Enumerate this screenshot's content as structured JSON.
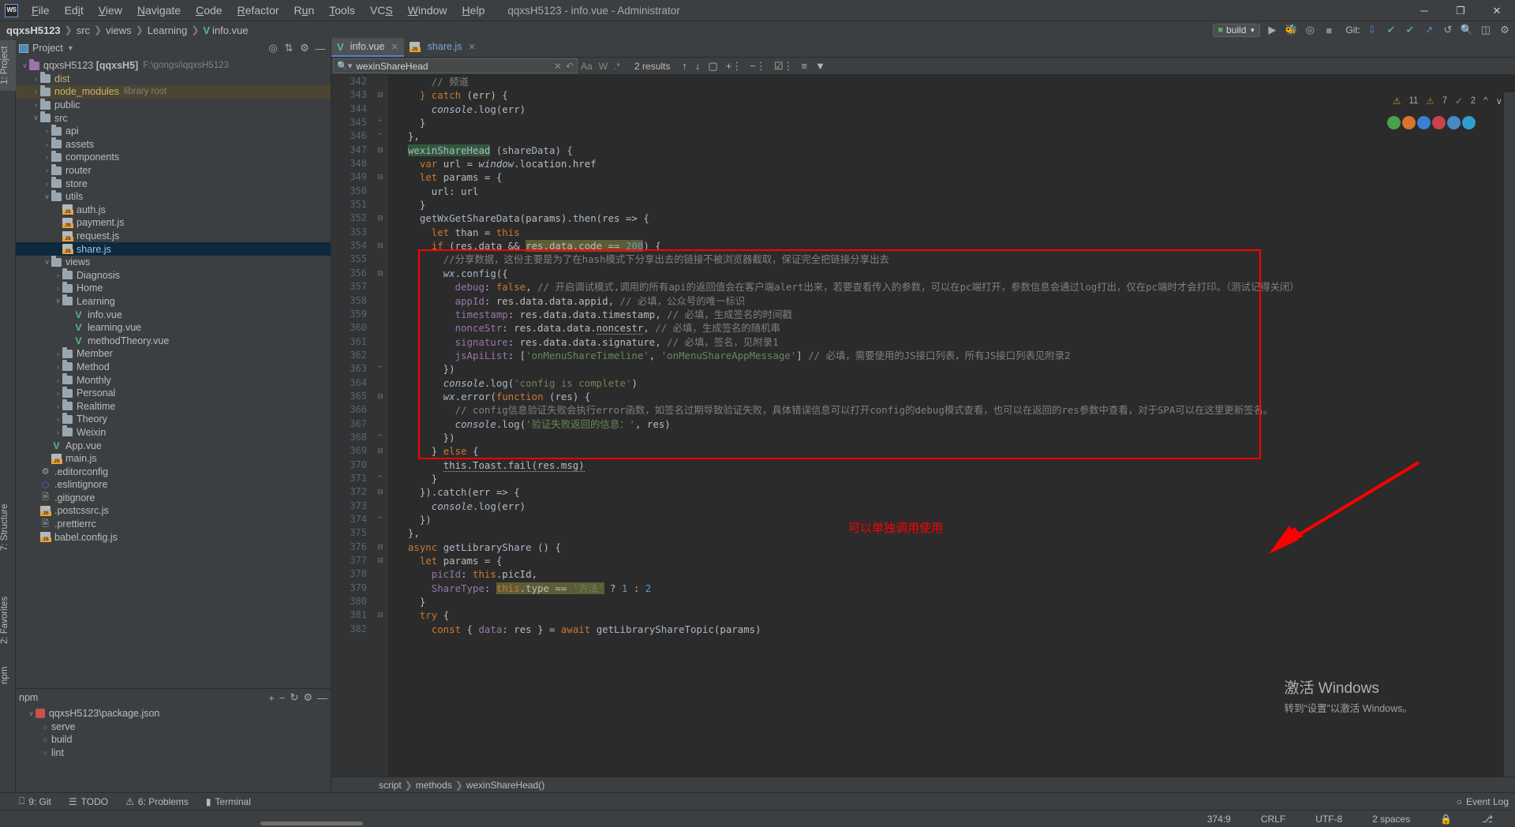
{
  "window": {
    "title": "qqxsH5123 - info.vue - Administrator",
    "logo": "WS",
    "minimize": "─",
    "maximize": "❐",
    "close": "✕"
  },
  "menu": [
    "File",
    "Edit",
    "View",
    "Navigate",
    "Code",
    "Refactor",
    "Run",
    "Tools",
    "VCS",
    "Window",
    "Help"
  ],
  "breadcrumb": {
    "project": "qqxsH5123",
    "items": [
      "src",
      "views",
      "Learning"
    ],
    "file": "info.vue",
    "file_icon": "vue-icon"
  },
  "navbar_right": {
    "build_config": "build",
    "run_icon": "run-icon",
    "debug_icon": "debug-icon",
    "coverage_icon": "coverage-icon",
    "stop_icon": "stop-icon",
    "git_label": "Git:",
    "update_icon": "update-project-icon",
    "commit_icon": "commit-icon",
    "push_icon": "push-icon",
    "history_icon": "history-icon",
    "search_icon": "search-everywhere-icon",
    "layout_icon": "layout-icon",
    "settings_icon": "settings-icon"
  },
  "left_strip": {
    "project_tab": "1: Project",
    "structure_tab": "7: Structure",
    "favorites_tab": "2: Favorites",
    "npm_tab": "npm"
  },
  "project_panel": {
    "title": "Project",
    "chevron": "▾",
    "toolbar_icons": [
      "locate-icon",
      "collapse-all-icon",
      "settings-icon",
      "hide-icon"
    ],
    "tree": [
      {
        "indent": 0,
        "arrow": "∨",
        "icon": "folder-purple",
        "label": "qqxsH5123",
        "bold": " [qqxsH5]",
        "hint": "F:\\gongsi\\qqxsH5123",
        "style": "grey"
      },
      {
        "indent": 1,
        "arrow": "›",
        "icon": "folder",
        "label": "dist",
        "style": "yellow"
      },
      {
        "indent": 1,
        "arrow": "›",
        "icon": "folder",
        "label": "node_modules",
        "hint": "library root",
        "style": "yellow",
        "rowclass": "lib"
      },
      {
        "indent": 1,
        "arrow": "›",
        "icon": "folder",
        "label": "public",
        "style": "grey"
      },
      {
        "indent": 1,
        "arrow": "∨",
        "icon": "folder",
        "label": "src",
        "style": "grey"
      },
      {
        "indent": 2,
        "arrow": "›",
        "icon": "folder",
        "label": "api",
        "style": "grey"
      },
      {
        "indent": 2,
        "arrow": "›",
        "icon": "folder",
        "label": "assets",
        "style": "grey"
      },
      {
        "indent": 2,
        "arrow": "›",
        "icon": "folder",
        "label": "components",
        "style": "grey"
      },
      {
        "indent": 2,
        "arrow": "›",
        "icon": "folder",
        "label": "router",
        "style": "grey"
      },
      {
        "indent": 2,
        "arrow": "›",
        "icon": "folder",
        "label": "store",
        "style": "grey"
      },
      {
        "indent": 2,
        "arrow": "∨",
        "icon": "folder",
        "label": "utils",
        "style": "grey"
      },
      {
        "indent": 3,
        "arrow": "",
        "icon": "js",
        "label": "auth.js",
        "style": "grey"
      },
      {
        "indent": 3,
        "arrow": "",
        "icon": "js",
        "label": "payment.js",
        "style": "grey"
      },
      {
        "indent": 3,
        "arrow": "",
        "icon": "js",
        "label": "request.js",
        "style": "grey"
      },
      {
        "indent": 3,
        "arrow": "",
        "icon": "js",
        "label": "share.js",
        "style": "blue",
        "rowclass": "sel"
      },
      {
        "indent": 2,
        "arrow": "∨",
        "icon": "folder",
        "label": "views",
        "style": "grey"
      },
      {
        "indent": 3,
        "arrow": "›",
        "icon": "folder",
        "label": "Diagnosis",
        "style": "grey"
      },
      {
        "indent": 3,
        "arrow": "›",
        "icon": "folder",
        "label": "Home",
        "style": "grey"
      },
      {
        "indent": 3,
        "arrow": "∨",
        "icon": "folder",
        "label": "Learning",
        "style": "grey"
      },
      {
        "indent": 4,
        "arrow": "",
        "icon": "vue",
        "label": "info.vue",
        "style": "grey"
      },
      {
        "indent": 4,
        "arrow": "",
        "icon": "vue",
        "label": "learning.vue",
        "style": "grey"
      },
      {
        "indent": 4,
        "arrow": "",
        "icon": "vue",
        "label": "methodTheory.vue",
        "style": "grey"
      },
      {
        "indent": 3,
        "arrow": "›",
        "icon": "folder",
        "label": "Member",
        "style": "grey"
      },
      {
        "indent": 3,
        "arrow": "›",
        "icon": "folder",
        "label": "Method",
        "style": "grey"
      },
      {
        "indent": 3,
        "arrow": "›",
        "icon": "folder",
        "label": "Monthly",
        "style": "grey"
      },
      {
        "indent": 3,
        "arrow": "›",
        "icon": "folder",
        "label": "Personal",
        "style": "grey"
      },
      {
        "indent": 3,
        "arrow": "›",
        "icon": "folder",
        "label": "Realtime",
        "style": "grey"
      },
      {
        "indent": 3,
        "arrow": "›",
        "icon": "folder",
        "label": "Theory",
        "style": "grey"
      },
      {
        "indent": 3,
        "arrow": "›",
        "icon": "folder",
        "label": "Weixin",
        "style": "grey"
      },
      {
        "indent": 2,
        "arrow": "",
        "icon": "vue",
        "label": "App.vue",
        "style": "grey"
      },
      {
        "indent": 2,
        "arrow": "",
        "icon": "js",
        "label": "main.js",
        "style": "grey"
      },
      {
        "indent": 1,
        "arrow": "",
        "icon": "gear",
        "label": ".editorconfig",
        "style": "grey"
      },
      {
        "indent": 1,
        "arrow": "",
        "icon": "eslint",
        "label": ".eslintignore",
        "style": "grey"
      },
      {
        "indent": 1,
        "arrow": "",
        "icon": "gitfile",
        "label": ".gitignore",
        "style": "grey"
      },
      {
        "indent": 1,
        "arrow": "",
        "icon": "js",
        "label": ".postcssrc.js",
        "style": "grey"
      },
      {
        "indent": 1,
        "arrow": "",
        "icon": "prettier",
        "label": ".prettierrc",
        "style": "grey"
      },
      {
        "indent": 1,
        "arrow": "",
        "icon": "js",
        "label": "babel.config.js",
        "style": "grey"
      }
    ]
  },
  "npm_panel": {
    "title": "npm",
    "toolbar_icons": [
      "add-icon",
      "remove-icon",
      "reload-icon",
      "settings-icon",
      "hide-icon"
    ],
    "items": [
      {
        "indent": 0,
        "icon": "package-json",
        "label": "qqxsH5123\\package.json",
        "arrow": "∨"
      },
      {
        "indent": 1,
        "icon": "script",
        "label": "serve"
      },
      {
        "indent": 1,
        "icon": "script",
        "label": "build"
      },
      {
        "indent": 1,
        "icon": "script",
        "label": "lint"
      }
    ]
  },
  "editor_tabs": [
    {
      "label": "info.vue",
      "icon": "vue-icon",
      "active": true,
      "close": "✕"
    },
    {
      "label": "share.js",
      "icon": "js-icon",
      "active": false,
      "close": "✕"
    }
  ],
  "search": {
    "value": "wexinShareHead",
    "placeholder": "Search",
    "results_label": "2 results",
    "clear_icon": "clear-icon",
    "history_icon": "search-history-icon",
    "match_case": "Aa",
    "words": "W",
    "regex": ".*",
    "prev_icon": "↑",
    "next_icon": "↓",
    "select_all_icon": "select-all-icon",
    "add_line_icon": "add-line-icon",
    "remove_line_icon": "remove-line-icon",
    "open_results_icon": "open-results-icon",
    "multiline_icon": "multiline-icon",
    "filter_icon": "filter-icon"
  },
  "inspections": {
    "warnings": "11",
    "weak_warnings": "7",
    "typos": "2",
    "warn_icon": "warning-icon",
    "weak_icon": "weak-warning-icon",
    "typo_icon": "typo-icon",
    "up_icon": "⌃",
    "down_icon": "⌄"
  },
  "code": {
    "first_line": 342,
    "lines": [
      {
        "n": 342,
        "fold": "",
        "html": "      <span class='cmt'>// 频道</span>"
      },
      {
        "n": 343,
        "fold": "-",
        "html": "    <span class='kw'>}</span> <span class='kw'>catch</span> (err) {"
      },
      {
        "n": 344,
        "fold": "",
        "html": "      <span class='ital'>console</span>.<span class='cfn'>log</span>(err)"
      },
      {
        "n": 345,
        "fold": "△",
        "html": "    }"
      },
      {
        "n": 346,
        "fold": "△",
        "html": "  },"
      },
      {
        "n": 347,
        "fold": "-",
        "html": "  <span class='hl'>wexinShareHead</span> <span class='cfn'>(</span><span class='ident'>shareData</span><span class='cfn'>) {</span>"
      },
      {
        "n": 348,
        "fold": "",
        "html": "    <span class='kw'>var</span> url = <span class='ital'>window</span>.location.href"
      },
      {
        "n": 349,
        "fold": "-",
        "html": "    <span class='kw'>let</span> params = {"
      },
      {
        "n": 350,
        "fold": "",
        "html": "      url: url"
      },
      {
        "n": 351,
        "fold": "",
        "html": "    }"
      },
      {
        "n": 352,
        "fold": "-",
        "html": "    <span class='cfn'>getWxGetShareData</span>(params).<span class='cfn'>then</span>(res =&gt; {"
      },
      {
        "n": 353,
        "fold": "",
        "html": "      <span class='kw'>let</span> than = <span class='kw'>this</span>"
      },
      {
        "n": 354,
        "fold": "-",
        "html": "      <span class='kw'>if</span> (res.data &amp;&amp; <span class='hl2'>res.data.code == <span class='num'>200</span></span>) {"
      },
      {
        "n": 355,
        "fold": "",
        "html": "        <span class='cmt'>//分享数据，这份主要是为了在hash模式下分享出去的链接不被浏览器截取，保证完全把链接分享出去</span>"
      },
      {
        "n": 356,
        "fold": "-",
        "html": "        <span class='ital'>wx</span>.<span class='cfn'>config</span>({"
      },
      {
        "n": 357,
        "fold": "",
        "html": "          <span class='fld'>debug</span>: <span class='kw'>false</span>, <span class='cmt'>// 开启调试模式,调用的所有api的返回值会在客户端alert出来，若要查看传入的参数，可以在pc端打开，参数信息会通过log打出，仅在pc端时才会打印。（测试记得关闭）</span>"
      },
      {
        "n": 358,
        "fold": "",
        "html": "          <span class='fld'>appId</span>: res.data.data.appid, <span class='cmt'>// 必填，公众号的唯一标识</span>"
      },
      {
        "n": 359,
        "fold": "",
        "html": "          <span class='fld'>timestamp</span>: res.data.data.timestamp, <span class='cmt'>// 必填，生成签名的时间戳</span>"
      },
      {
        "n": 360,
        "fold": "",
        "html": "          <span class='fld'>nonceStr</span>: res.data.data.<span class='wavy'>noncestr</span>, <span class='cmt'>// 必填，生成签名的随机串</span>"
      },
      {
        "n": 361,
        "fold": "",
        "html": "          <span class='fld'>signature</span>: res.data.data.signature, <span class='cmt'>// 必填，签名，见附录1</span>"
      },
      {
        "n": 362,
        "fold": "",
        "html": "          <span class='fld'>jsApiList</span>: [<span class='str'>'onMenuShareTimeline'</span>, <span class='str'>'onMenuShareAppMessage'</span>] <span class='cmt'>// 必填，需要使用的JS接口列表，所有JS接口列表见附录2</span>"
      },
      {
        "n": 363,
        "fold": "△",
        "html": "        })"
      },
      {
        "n": 364,
        "fold": "",
        "html": "        <span class='ital'>console</span>.<span class='cfn'>log</span>(<span class='str'>'config is complete'</span>)"
      },
      {
        "n": 365,
        "fold": "-",
        "html": "        <span class='ital'>wx</span>.<span class='cfn'>error</span>(<span class='kw'>function</span> (res) {"
      },
      {
        "n": 366,
        "fold": "",
        "html": "          <span class='cmt'>// config信息验证失败会执行error函数，如签名过期导致验证失败，具体错误信息可以打开config的debug模式查看，也可以在返回的res参数中查看，对于SPA可以在这里更新签名。</span>"
      },
      {
        "n": 367,
        "fold": "",
        "html": "          <span class='ital'>console</span>.<span class='cfn'>log</span>(<span class='str'>'验证失败返回的信息：'</span>, res)"
      },
      {
        "n": 368,
        "fold": "△",
        "html": "        })"
      },
      {
        "n": 369,
        "fold": "-",
        "html": "      } <span class='kw'>else</span> {"
      },
      {
        "n": 370,
        "fold": "",
        "html": "        <span class='wavy'>this.Toast.fail(res.msg)</span>"
      },
      {
        "n": 371,
        "fold": "△",
        "html": "      }"
      },
      {
        "n": 372,
        "fold": "-",
        "html": "    }).<span class='cfn'>catch</span>(err =&gt; {"
      },
      {
        "n": 373,
        "fold": "",
        "html": "      <span class='ital'>console</span>.<span class='cfn'>log</span>(err)"
      },
      {
        "n": 374,
        "fold": "△",
        "html": "    })"
      },
      {
        "n": 375,
        "fold": "",
        "html": "  },"
      },
      {
        "n": 376,
        "fold": "-",
        "html": "  <span class='kw'>async</span> <span class='cfn'>getLibraryShare</span> () {"
      },
      {
        "n": 377,
        "fold": "-",
        "html": "    <span class='kw'>let</span> params = {"
      },
      {
        "n": 378,
        "fold": "",
        "html": "      <span class='fld'>picId</span>: <span class='kw'>this</span>.picId,"
      },
      {
        "n": 379,
        "fold": "",
        "html": "      <span class='fld'>ShareType</span>: <span class='hl2'><span class='kw'>this</span>.type == <span class='str'>'方法'</span></span> ? <span class='num'>1</span> : <span class='num'>2</span>"
      },
      {
        "n": 380,
        "fold": "",
        "html": "    }"
      },
      {
        "n": 381,
        "fold": "-",
        "html": "    <span class='kw'>try</span> {"
      },
      {
        "n": 382,
        "fold": "",
        "html": "      <span class='kw'>const</span> { <span class='fld'>data</span>: res } = <span class='kw'>await</span> <span class='cfn'>getLibraryShareTopic</span>(params)"
      }
    ]
  },
  "annotation": {
    "text": "可以单独调用使用",
    "color": "#ff0000"
  },
  "bottom_breadcrumb": [
    "script",
    "methods",
    "wexinShareHead()"
  ],
  "bottom_tools": [
    {
      "label": "9: Git",
      "icon": "git-icon"
    },
    {
      "label": "TODO",
      "icon": "todo-icon"
    },
    {
      "label": "6: Problems",
      "icon": "problems-icon"
    },
    {
      "label": "Terminal",
      "icon": "terminal-icon"
    }
  ],
  "status_bar": {
    "event_log": "Event Log",
    "event_log_icon": "event-log-icon",
    "caret": "374:9",
    "line_sep": "CRLF",
    "encoding": "UTF-8",
    "indent": "2 spaces",
    "branch_icon": "branch-icon",
    "lock_icon": "lock-icon"
  },
  "watermark": {
    "line1": "激活 Windows",
    "line2": "转到“设置”以激活 Windows。"
  },
  "colors": {
    "bg": "#3c3f41",
    "editor_bg": "#2b2b2b",
    "accent": "#4a88c7",
    "annotation_red": "#ff0000",
    "selection": "#0d293e",
    "highlight_green": "#32593d",
    "library_row": "#4b4632"
  }
}
